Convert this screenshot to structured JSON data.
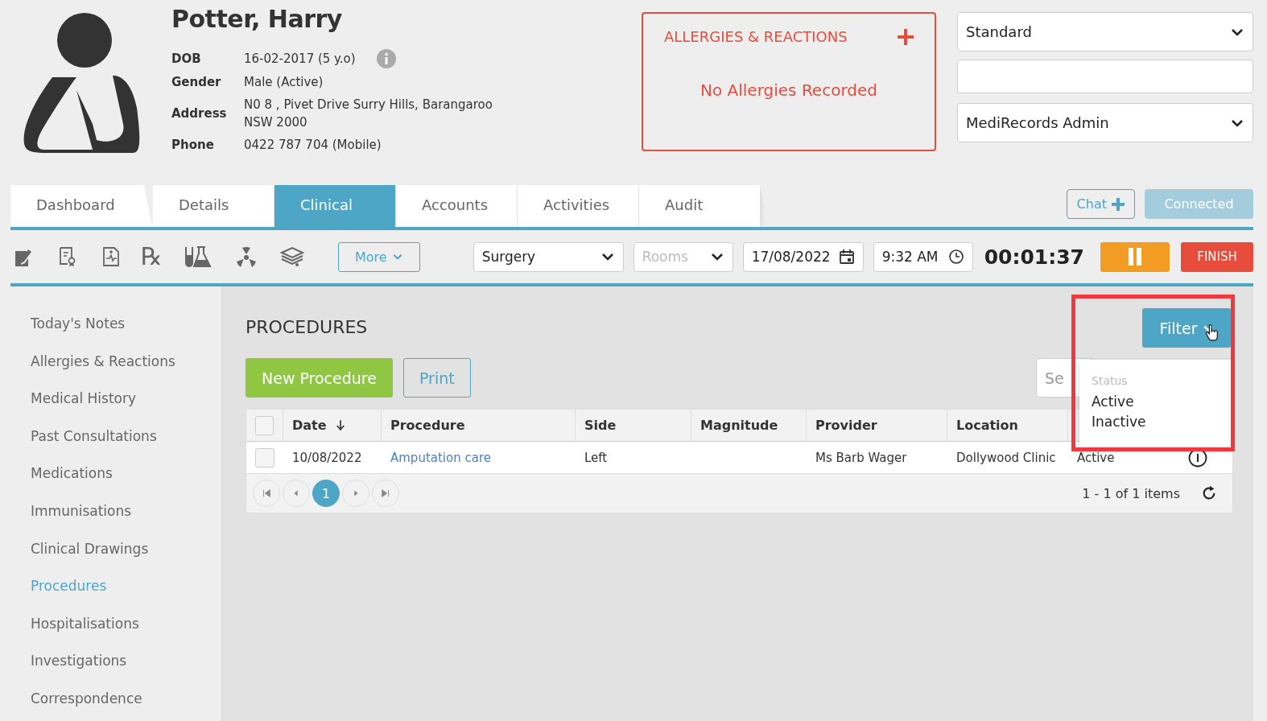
{
  "patient": {
    "name": "Potter, Harry",
    "fields": [
      {
        "label": "DOB",
        "value": "16-02-2017 (5 y.o)",
        "info": true
      },
      {
        "label": "Gender",
        "value": "Male (Active)",
        "info": false
      },
      {
        "label": "Address",
        "value": "N0 8 , Pivet Drive Surry Hills, Barangaroo\nNSW 2000",
        "info": false
      },
      {
        "label": "Phone",
        "value": "0422 787 704 (Mobile)",
        "info": false
      }
    ]
  },
  "allergies": {
    "title": "ALLERGIES & REACTIONS",
    "message": "No Allergies Recorded"
  },
  "header_fields": [
    {
      "kind": "select",
      "value": "Standard"
    },
    {
      "kind": "input"
    },
    {
      "kind": "select",
      "value": "MediRecords Admin"
    }
  ],
  "tabs": [
    {
      "label": "Dashboard",
      "selected": false
    },
    {
      "label": "Details",
      "selected": false
    },
    {
      "label": "Clinical",
      "selected": true
    },
    {
      "label": "Accounts",
      "selected": false
    },
    {
      "label": "Activities",
      "selected": false
    },
    {
      "label": "Audit",
      "selected": false
    }
  ],
  "chat_button": "Chat",
  "connection_status": "Connected",
  "toolbar": {
    "rx_symbol": "℞",
    "more": "More",
    "location": "Surgery",
    "room_placeholder": "Rooms",
    "date": "17/08/2022",
    "time": "9:32 AM",
    "timer": "00:01:37",
    "finish": "FINISH"
  },
  "sidebar": {
    "items": [
      {
        "label": "Today's Notes",
        "selected": false
      },
      {
        "label": "Allergies & Reactions",
        "selected": false
      },
      {
        "label": "Medical History",
        "selected": false
      },
      {
        "label": "Past Consultations",
        "selected": false
      },
      {
        "label": "Medications",
        "selected": false
      },
      {
        "label": "Immunisations",
        "selected": false
      },
      {
        "label": "Clinical Drawings",
        "selected": false
      },
      {
        "label": "Procedures",
        "selected": true
      },
      {
        "label": "Hospitalisations",
        "selected": false
      },
      {
        "label": "Investigations",
        "selected": false
      },
      {
        "label": "Correspondence",
        "selected": false
      }
    ]
  },
  "page_title": "PROCEDURES",
  "new_button": "New Procedure",
  "print_button": "Print",
  "search": {
    "placeholder": "Se"
  },
  "filter": {
    "label": "Filter",
    "heading": "Status",
    "options": [
      "Active",
      "Inactive"
    ]
  },
  "table": {
    "select_all": {
      "checked": false
    },
    "columns": [
      {
        "label": "Date",
        "sorted": true
      },
      {
        "label": "Procedure",
        "sorted": false
      },
      {
        "label": "Side",
        "sorted": false
      },
      {
        "label": "Magnitude",
        "sorted": false
      },
      {
        "label": "Provider",
        "sorted": false
      },
      {
        "label": "Location",
        "sorted": false
      }
    ],
    "rows": [
      {
        "checked": false,
        "date": "10/08/2022",
        "procedure": "Amputation care",
        "side": "Left",
        "provider": "Ms Barb Wager",
        "location": "Dollywood Clinic",
        "status": "Active"
      }
    ]
  },
  "pagination": {
    "pages": [
      {
        "label": "1",
        "selected": true
      }
    ],
    "summary": "1 - 1 of 1 items"
  }
}
